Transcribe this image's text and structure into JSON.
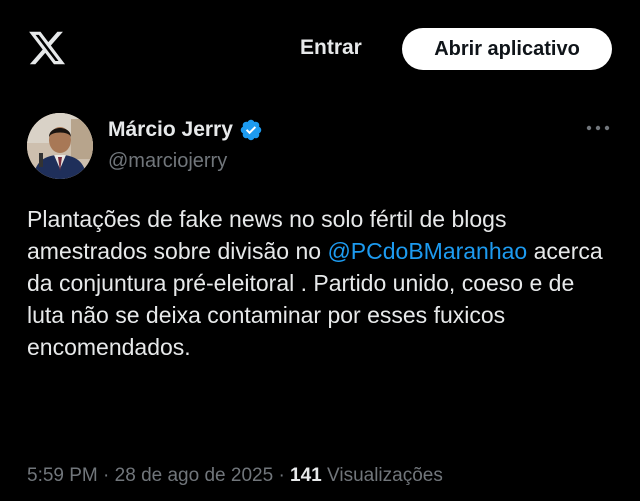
{
  "header": {
    "logo_icon": "x-logo-icon",
    "login_label": "Entrar",
    "open_app_label": "Abrir aplicativo"
  },
  "tweet": {
    "author_name": "Márcio Jerry",
    "handle": "@marciojerry",
    "verified_icon": "verified-badge-icon",
    "more_icon": "more-options-icon",
    "text_part1": "Plantações de fake news no solo fértil de blogs amestrados sobre divisão no ",
    "mention": "@PCdoBMaranhao",
    "text_part2": " acerca da conjuntura pré-eleitoral . Partido unido, coeso e de luta não se deixa contaminar por esses fuxicos encomendados.",
    "time": "5:59 PM",
    "date": "28 de ago de 2025",
    "separator": "·",
    "views_count": "141",
    "views_label": "Visualizações"
  },
  "colors": {
    "background": "#000000",
    "text": "#e7e9ea",
    "secondary_text": "#71767b",
    "link": "#1d9bf0",
    "verified": "#1d9bf0"
  }
}
